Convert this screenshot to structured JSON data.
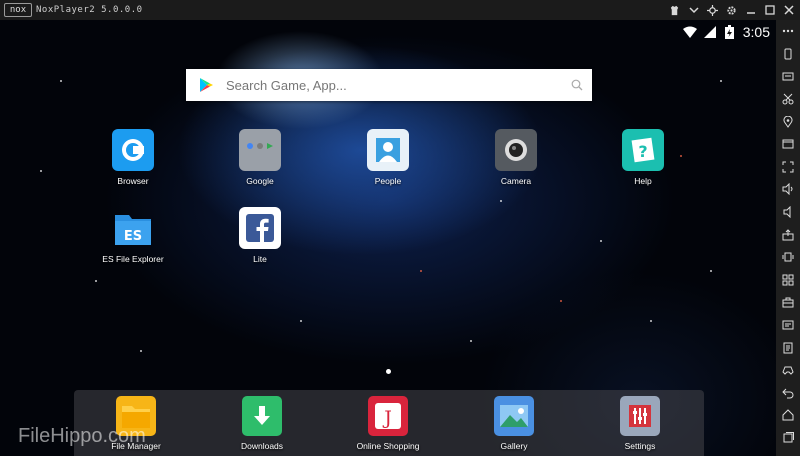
{
  "window": {
    "logo": "nox",
    "title": "NoxPlayer2 5.0.0.0"
  },
  "status": {
    "time": "3:05"
  },
  "search": {
    "placeholder": "Search Game, App..."
  },
  "apps": [
    {
      "label": "Browser",
      "icon": "browser-icon"
    },
    {
      "label": "Google",
      "icon": "google-folder-icon"
    },
    {
      "label": "People",
      "icon": "people-icon"
    },
    {
      "label": "Camera",
      "icon": "camera-icon"
    },
    {
      "label": "Help",
      "icon": "help-icon"
    },
    {
      "label": "ES File Explorer",
      "icon": "es-file-explorer-icon"
    },
    {
      "label": "Lite",
      "icon": "facebook-lite-icon"
    }
  ],
  "dock": [
    {
      "label": "File Manager",
      "icon": "folder-icon"
    },
    {
      "label": "Downloads",
      "icon": "download-icon"
    },
    {
      "label": "Online Shopping",
      "icon": "shopping-icon"
    },
    {
      "label": "Gallery",
      "icon": "gallery-icon"
    },
    {
      "label": "Settings",
      "icon": "settings-icon"
    }
  ],
  "watermark": "FileHippo.com",
  "toolbar_icons": [
    "more-icon",
    "rotate-icon",
    "keyboard-icon",
    "scissors-icon",
    "location-icon",
    "screen-icon",
    "fullscreen-icon",
    "volume-up-icon",
    "volume-down-icon",
    "install-apk-icon",
    "shake-icon",
    "multi-instance-icon",
    "toolbox-icon",
    "macro-icon",
    "script-icon",
    "controller-icon",
    "back-icon",
    "home-icon",
    "recent-apps-icon"
  ],
  "colors": {
    "titlebar": "#1b1b1b",
    "sidebar": "#1e1e1e",
    "accent": "#1c9cf0"
  }
}
